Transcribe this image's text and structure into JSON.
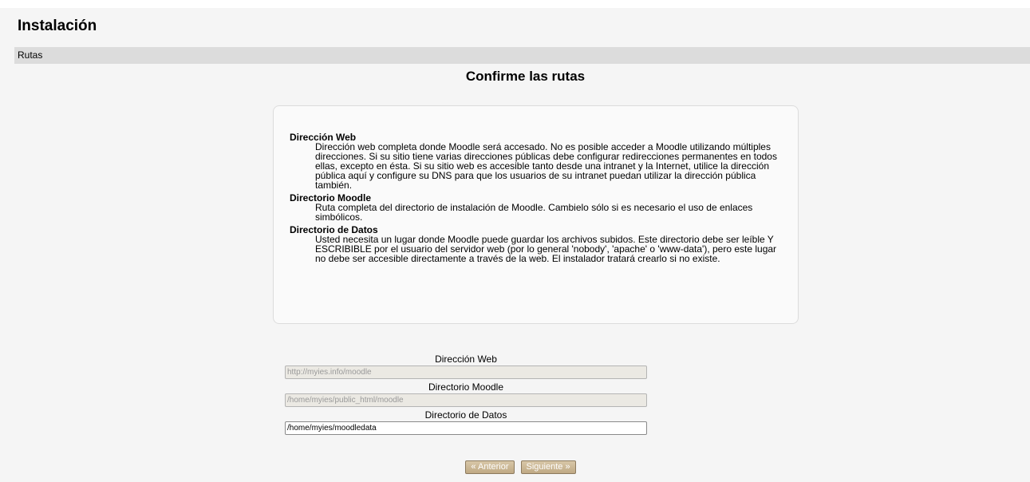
{
  "header": {
    "title": "Instalación"
  },
  "nav": {
    "breadcrumb": "Rutas"
  },
  "main": {
    "heading": "Confirme las rutas"
  },
  "info": {
    "items": [
      {
        "term": "Dirección Web",
        "desc": "Dirección web completa donde Moodle será accesado. No es posible acceder a Moodle utilizando múltiples direcciones. Si su sitio tiene varias direcciones públicas debe configurar redirecciones permanentes en todos ellas, excepto en ésta. Si su sitio web es accesible tanto desde una intranet y la Internet, utilice la dirección pública aquí y configure su DNS para que los usuarios de su intranet puedan utilizar la dirección pública también."
      },
      {
        "term": "Directorio Moodle",
        "desc": "Ruta completa del directorio de instalación de Moodle. Cambielo sólo si es necesario el uso de enlaces simbólicos."
      },
      {
        "term": "Directorio de Datos",
        "desc": "Usted necesita un lugar donde Moodle puede guardar los archivos subidos. Este directorio debe ser leíble Y ESCRIBIBLE por el usuario del servidor web (por lo general 'nobody', 'apache' o 'www-data'), pero este lugar no debe ser accesible directamente a través de la web. El instalador tratará crearlo si no existe."
      }
    ]
  },
  "form": {
    "wwwroot": {
      "label": "Dirección Web",
      "value": "http://myies.info/moodle"
    },
    "dirroot": {
      "label": "Directorio Moodle",
      "value": "/home/myies/public_html/moodle"
    },
    "dataroot": {
      "label": "Directorio de Datos",
      "value": "/home/myies/moodledata"
    }
  },
  "buttons": {
    "previous": "« Anterior",
    "next": "Siguiente »"
  }
}
